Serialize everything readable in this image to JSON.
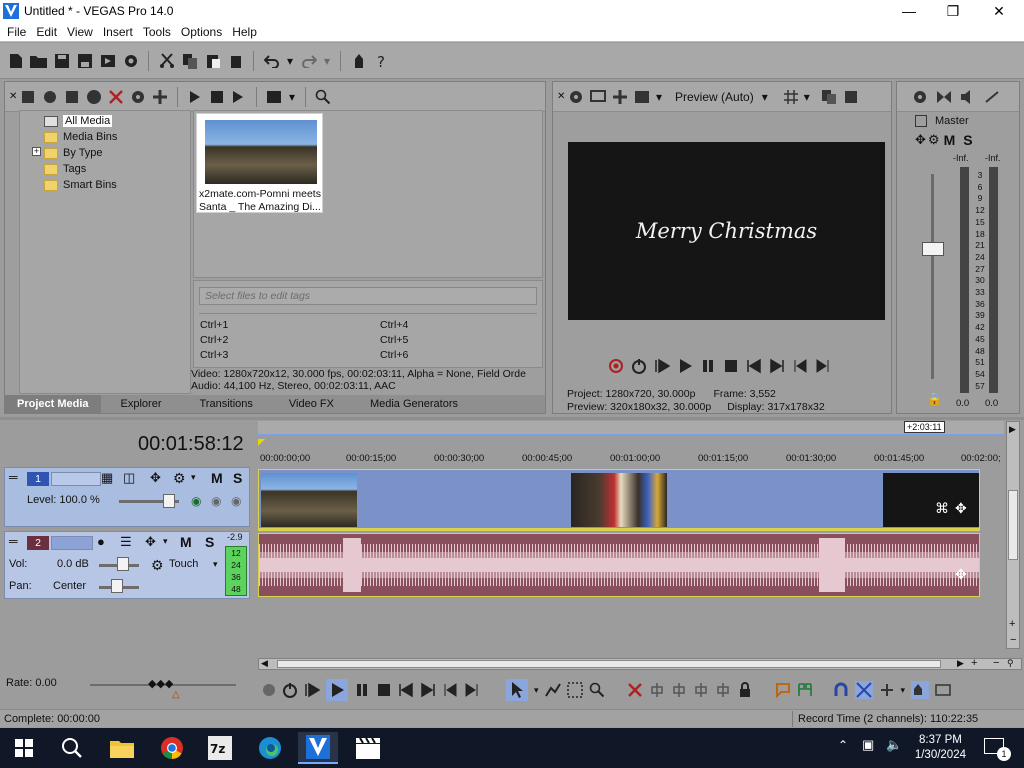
{
  "window": {
    "title": "Untitled * - VEGAS Pro 14.0",
    "minimize_icon": "minimize-icon",
    "maximize_icon": "restore-icon",
    "close_icon": "close-icon"
  },
  "menu": [
    "File",
    "Edit",
    "View",
    "Insert",
    "Tools",
    "Options",
    "Help"
  ],
  "toolbar": {
    "icons": [
      "new-file-icon",
      "open-folder-icon",
      "save-icon",
      "save-as-icon",
      "render-icon",
      "properties-icon",
      "cut-icon",
      "copy-icon",
      "paste-icon",
      "delete-icon",
      "undo-icon",
      "redo-icon",
      "explore-icon",
      "help-icon"
    ]
  },
  "project_media": {
    "tree": [
      "All Media",
      "Media Bins",
      "By Type",
      "Tags",
      "Smart Bins"
    ],
    "clip_caption": "x2mate.com-Pomni meets Santa _ The Amazing Di...",
    "tag_placeholder": "Select files to edit tags",
    "shortcuts_left": [
      "Ctrl+1",
      "Ctrl+2",
      "Ctrl+3"
    ],
    "shortcuts_right": [
      "Ctrl+4",
      "Ctrl+5",
      "Ctrl+6"
    ],
    "info_video": "Video: 1280x720x12, 30.000 fps, 00:02:03:11, Alpha = None, Field Orde",
    "info_audio": "Audio: 44,100 Hz, Stereo, 00:02:03:11, AAC",
    "tabs": [
      "Project Media",
      "Explorer",
      "Transitions",
      "Video FX",
      "Media Generators"
    ]
  },
  "preview": {
    "mode": "Preview (Auto)",
    "screen_text": "Merry Christmas",
    "project": "Project:   1280x720, 30.000p",
    "frame": "Frame:      3,552",
    "preview_res": "Preview:  320x180x32, 30.000p",
    "display": "Display:   317x178x32"
  },
  "master": {
    "title": "Master",
    "m_label": "M",
    "s_label": "S",
    "inf_left": "-Inf.",
    "inf_right": "-Inf.",
    "scale": [
      "3",
      "6",
      "9",
      "12",
      "15",
      "18",
      "21",
      "24",
      "27",
      "30",
      "33",
      "36",
      "39",
      "42",
      "45",
      "48",
      "51",
      "54",
      "57"
    ],
    "bottom_left": "0.0",
    "bottom_right": "0.0"
  },
  "timeline": {
    "timecode": "00:01:58:12",
    "end_marker": "+2:03:11",
    "ruler": [
      "00:00:00;00",
      "00:00:15;00",
      "00:00:30;00",
      "00:00:45;00",
      "00:01:00;00",
      "00:01:15;00",
      "00:01:30;00",
      "00:01:45;00",
      "00:02:00;"
    ],
    "track1": {
      "number": "1",
      "level": "Level: 100.0 %",
      "m": "M",
      "s": "S"
    },
    "track2": {
      "number": "2",
      "vol": "Vol:",
      "vol_value": "0.0 dB",
      "pan": "Pan:",
      "pan_value": "Center",
      "touch": "Touch",
      "m": "M",
      "s": "S",
      "meter_top": "-2.9",
      "meter_scale": [
        "12",
        "24",
        "36",
        "48"
      ]
    },
    "rate": "Rate: 0.00"
  },
  "status": {
    "left": "Complete: 00:00:00",
    "right": "Record Time (2 channels): 110:22:35"
  },
  "taskbar": {
    "time": "8:37 PM",
    "date": "1/30/2024",
    "notification_count": "1"
  },
  "colors": {
    "accent_blue": "#7b92c8",
    "audio_clip": "#c09ca6",
    "clip_border": "#d9d24e",
    "taskbar": "#101828"
  }
}
